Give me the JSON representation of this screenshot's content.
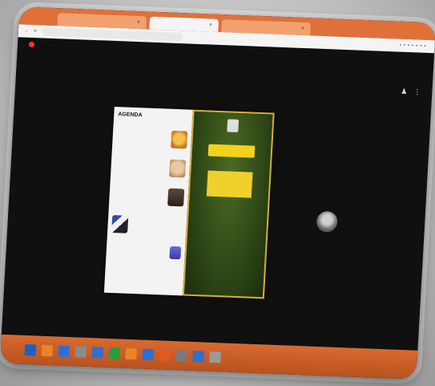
{
  "browser": {
    "tabs": [
      {
        "label": "",
        "active": false
      },
      {
        "label": "",
        "active": true
      },
      {
        "label": "",
        "active": false
      }
    ],
    "address": ""
  },
  "meet": {
    "title": ""
  },
  "slide": {
    "agenda_title": "AGENDA",
    "agenda_items": [
      {
        "text": "",
        "img": "img-a"
      },
      {
        "text": "",
        "img": "img-b"
      },
      {
        "text": "",
        "img": "img-c"
      },
      {
        "text": "",
        "img": "img-d"
      },
      {
        "text": "",
        "img": "img-e"
      }
    ],
    "poster_heading": "",
    "poster_sub": "",
    "poster_topic": "",
    "poster_date": "",
    "poster_info": "",
    "poster_bottom": ""
  },
  "taskbar": {
    "icons": [
      "blue",
      "orange",
      "blue",
      "gray",
      "blue",
      "green",
      "orange",
      "blue",
      "orange",
      "gray",
      "blue",
      "gray"
    ],
    "clock": ""
  }
}
